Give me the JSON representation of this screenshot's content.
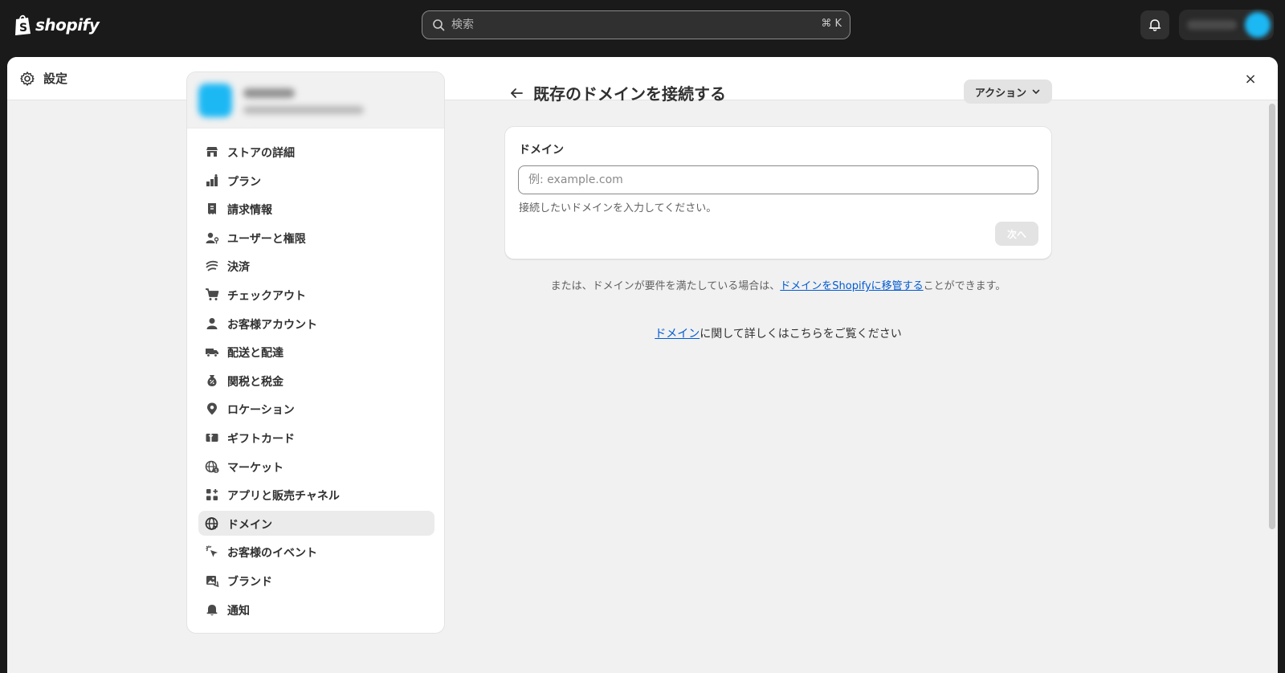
{
  "topbar": {
    "logo_text": "shopify",
    "search_placeholder": "検索",
    "search_shortcut": "⌘ K"
  },
  "modal": {
    "title": "設定",
    "close_label": "×"
  },
  "sidebar": {
    "items": [
      {
        "label": "ストアの詳細",
        "icon": "store-icon"
      },
      {
        "label": "プラン",
        "icon": "plan-icon"
      },
      {
        "label": "請求情報",
        "icon": "receipt-icon"
      },
      {
        "label": "ユーザーと権限",
        "icon": "user-permissions-icon"
      },
      {
        "label": "決済",
        "icon": "payments-icon"
      },
      {
        "label": "チェックアウト",
        "icon": "cart-icon"
      },
      {
        "label": "お客様アカウント",
        "icon": "person-icon"
      },
      {
        "label": "配送と配達",
        "icon": "truck-icon"
      },
      {
        "label": "関税と税金",
        "icon": "tax-bag-icon"
      },
      {
        "label": "ロケーション",
        "icon": "location-pin-icon"
      },
      {
        "label": "ギフトカード",
        "icon": "gift-card-icon"
      },
      {
        "label": "マーケット",
        "icon": "globe-market-icon"
      },
      {
        "label": "アプリと販売チャネル",
        "icon": "apps-icon"
      },
      {
        "label": "ドメイン",
        "icon": "globe-icon",
        "active": true
      },
      {
        "label": "お客様のイベント",
        "icon": "cursor-click-icon"
      },
      {
        "label": "ブランド",
        "icon": "brand-image-icon"
      },
      {
        "label": "通知",
        "icon": "bell-icon"
      }
    ]
  },
  "main": {
    "title": "既存のドメインを接続する",
    "actions_label": "アクション",
    "card": {
      "field_label": "ドメイン",
      "input_placeholder": "例: example.com",
      "help_text": "接続したいドメインを入力してください。",
      "next_label": "次へ"
    },
    "transfer": {
      "prefix": "または、ドメインが要件を満たしている場合は、",
      "link": "ドメインをShopifyに移管する",
      "suffix": "ことができます。"
    },
    "learn": {
      "link": "ドメイン",
      "suffix": "に関して詳しくはこちらをご覧ください"
    }
  },
  "colors": {
    "topbar": "#1a1a1a",
    "accent_link": "#005bd3",
    "avatar": "#1cb8f4"
  }
}
